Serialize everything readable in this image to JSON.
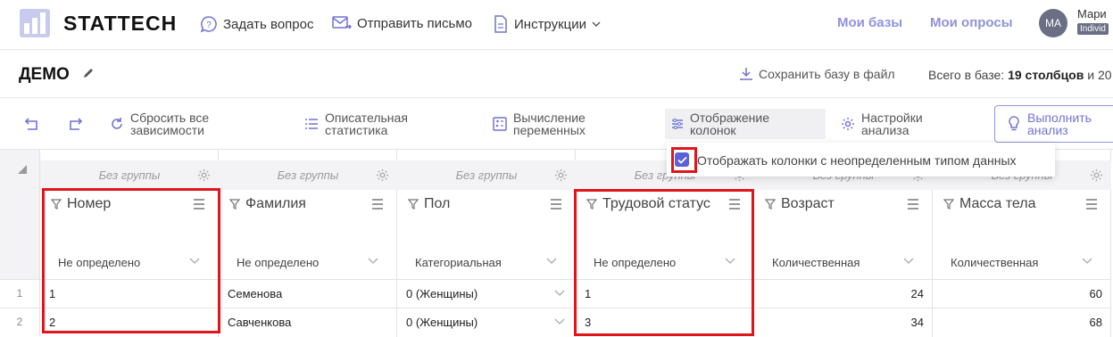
{
  "header": {
    "brand": "STATTECH",
    "ask": "Задать вопрос",
    "send": "Отправить письмо",
    "instructions": "Инструкции",
    "my_bases": "Мои базы",
    "my_surveys": "Мои опросы",
    "avatar_initials": "МА",
    "user_name": "Мари",
    "user_badge": "Individ"
  },
  "titlebar": {
    "title": "ДЕМО",
    "save_file": "Сохранить базу в файл",
    "db_info_prefix": "Всего в базе: ",
    "db_info_cols": "19 столбцов",
    "db_info_suffix": " и 20"
  },
  "toolbar": {
    "reset": [
      "Сбросить все",
      "зависимости"
    ],
    "descriptive": [
      "Описательная",
      "статистика"
    ],
    "compute": [
      "Вычисление",
      "переменных"
    ],
    "columns_display": [
      "Отображение",
      "колонок"
    ],
    "analysis_settings": [
      "Настройки",
      "анализа"
    ],
    "run": [
      "Выполнить",
      "анализ"
    ]
  },
  "popup": {
    "checkbox_label": "Отображать колонки с неопределенным типом данных",
    "checked": true
  },
  "grid": {
    "group_label": "Без группы",
    "columns": [
      {
        "name": "Номер",
        "type": "Не определено",
        "values": [
          "1",
          "2"
        ],
        "align": "left"
      },
      {
        "name": "Фамилия",
        "type": "Не определено",
        "values": [
          "Семенова",
          "Савченкова"
        ],
        "align": "left"
      },
      {
        "name": "Пол",
        "type": "Категориальная",
        "values": [
          "0 (Женщины)",
          "0 (Женщины)"
        ],
        "align": "left",
        "select": true
      },
      {
        "name": "Трудовой статус",
        "type": "Не определено",
        "values": [
          "1",
          "3"
        ],
        "align": "left"
      },
      {
        "name": "Возраст",
        "type": "Количественная",
        "values": [
          "24",
          "34"
        ],
        "align": "right"
      },
      {
        "name": "Масса тела",
        "type": "Количественная",
        "values": [
          "60",
          "68"
        ],
        "align": "right"
      }
    ],
    "row_numbers": [
      "1",
      "2"
    ]
  },
  "colors": {
    "accent": "#8f93d9",
    "highlight": "#e0151b",
    "checkbox": "#5b61d6"
  }
}
